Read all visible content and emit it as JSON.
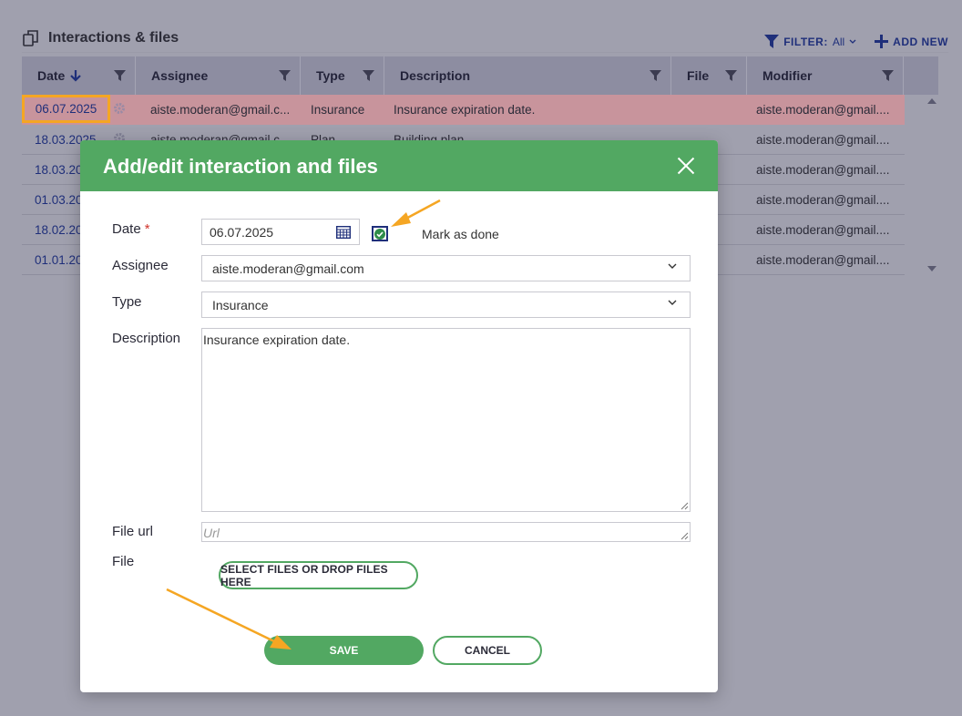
{
  "page": {
    "title": "Interactions & files",
    "filter_label": "FILTER:",
    "filter_value": "All",
    "add_new_label": "ADD NEW"
  },
  "grid": {
    "columns": [
      {
        "label": "Date"
      },
      {
        "label": "Assignee"
      },
      {
        "label": "Type"
      },
      {
        "label": "Description"
      },
      {
        "label": "File"
      },
      {
        "label": "Modifier"
      }
    ],
    "rows": [
      {
        "date": "06.07.2025",
        "assignee": "aiste.moderan@gmail.c...",
        "type": "Insurance",
        "description": "Insurance expiration date.",
        "modifier": "aiste.moderan@gmail...."
      },
      {
        "date": "18.03.2025",
        "assignee": "aiste.moderan@gmail.c...",
        "type": "Plan",
        "description": "Building plan",
        "modifier": "aiste.moderan@gmail...."
      },
      {
        "date": "18.03.20",
        "assignee": "",
        "type": "",
        "description": "",
        "modifier": "aiste.moderan@gmail...."
      },
      {
        "date": "01.03.20",
        "assignee": "",
        "type": "",
        "description": "",
        "modifier": "aiste.moderan@gmail...."
      },
      {
        "date": "18.02.20",
        "assignee": "",
        "type": "",
        "description": "",
        "modifier": "aiste.moderan@gmail...."
      },
      {
        "date": "01.01.20",
        "assignee": "",
        "type": "",
        "description": "",
        "modifier": "aiste.moderan@gmail...."
      }
    ]
  },
  "modal": {
    "title": "Add/edit interaction and files",
    "date_label": "Date",
    "required_mark": "*",
    "date_value": "06.07.2025",
    "mark_done_label": "Mark as done",
    "mark_done_checked": true,
    "assignee_label": "Assignee",
    "assignee_value": "aiste.moderan@gmail.com",
    "type_label": "Type",
    "type_value": "Insurance",
    "description_label": "Description",
    "description_value": "Insurance expiration date.",
    "file_url_label": "File url",
    "file_url_placeholder": "Url",
    "file_label": "File",
    "select_files_label": "SELECT FILES OR DROP FILES HERE",
    "save_label": "SAVE",
    "cancel_label": "CANCEL"
  },
  "colors": {
    "accent_green": "#52a862",
    "link_blue": "#1f2f7a",
    "highlight_orange": "#f5a623",
    "selected_row": "#c8949c"
  }
}
